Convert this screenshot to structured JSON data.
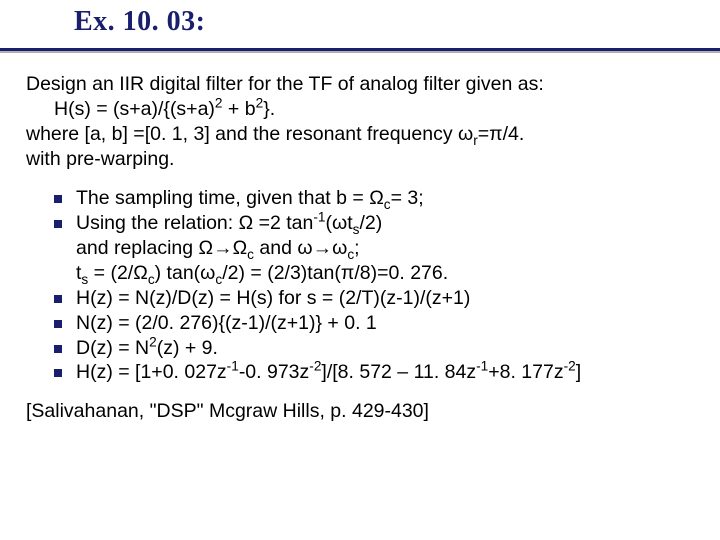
{
  "title": "Ex. 10. 03:",
  "intro": {
    "l1_a": "Design an IIR digital filter for  the TF of analog filter given as:",
    "l2_a": "H(s) = (s+a)/{(s+a)",
    "l2_b": " + b",
    "l2_c": "}.",
    "l3_a": "where [a, b] =[0. 1, 3]  and the resonant frequency ",
    "l3_b": "=",
    "l3_c": "/4.",
    "l4": "with pre-warping."
  },
  "bul": {
    "b1_a": "The sampling time, given that b = ",
    "b1_b": "= 3;",
    "b2_a": "Using the relation:     ",
    "b2_b": " =2 tan",
    "b2_c": "(",
    "b2_d": "t",
    "b2_e": "/2)",
    "b2c1_a": "and  replacing     ",
    "b2c1_b": "  and ",
    "b2c1_c": ";",
    "b2c2_a": "t",
    "b2c2_b": " = (2/",
    "b2c2_c": ") tan(",
    "b2c2_d": "/2) = (2/3)tan(",
    "b2c2_e": "/8)=0. 276.",
    "b3": "H(z) = N(z)/D(z) = H(s)  for s = (2/T)(z-1)/(z+1)",
    "b4": "N(z) = (2/0. 276){(z-1)/(z+1)}  + 0. 1",
    "b5_a": "D(z) = N",
    "b5_b": "(z) + 9.",
    "b6_a": "H(z) = [1+0. 027z",
    "b6_b": "-0. 973z",
    "b6_c": "]/[8. 572 – 11. 84z",
    "b6_d": "+8. 177z",
    "b6_e": "]"
  },
  "ref": "[Salivahanan, \"DSP\" Mcgraw Hills, p. 429-430]",
  "sym": {
    "omega_l": "ω",
    "omega_u": "Ω",
    "pi": "π",
    "arrow": "→"
  },
  "sub": {
    "r": "r",
    "c": "c",
    "s": "s"
  },
  "sup": {
    "two": "2",
    "m1": "-1",
    "m2": "-2"
  }
}
